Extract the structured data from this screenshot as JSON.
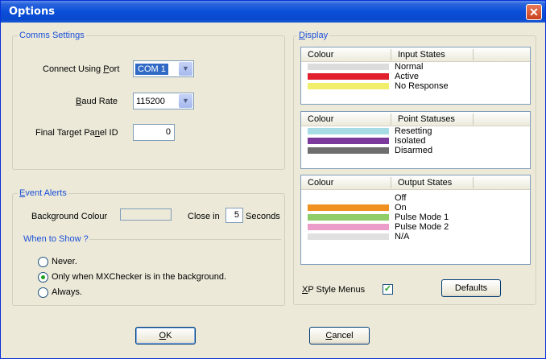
{
  "window": {
    "title": "Options",
    "close_glyph": "✕"
  },
  "comms": {
    "legend": "Comms Settings",
    "port_label_pre": "Connect Using ",
    "port_label_u": "P",
    "port_label_post": "ort",
    "port_value": "COM 1",
    "baud_label_pre": "",
    "baud_label_u": "B",
    "baud_label_post": "aud Rate",
    "baud_value": "115200",
    "panel_label_pre": "Final Target Pa",
    "panel_label_u": "n",
    "panel_label_post": "el ID",
    "panel_value": "0"
  },
  "event_alerts": {
    "legend_u": "E",
    "legend_post": "vent Alerts",
    "bg_colour_label": "Background Colour",
    "close_in_label": "Close in",
    "close_in_value": "5",
    "seconds_label": "Seconds"
  },
  "when_to_show": {
    "legend": "When to Show ?",
    "options": [
      {
        "label": "Never.",
        "checked": false
      },
      {
        "label": "Only when MXChecker is in the background.",
        "checked": true
      },
      {
        "label": "Always.",
        "checked": false
      }
    ]
  },
  "display": {
    "legend_u": "D",
    "legend_post": "isplay",
    "input_states": {
      "col1": "Colour",
      "col2": "Input States",
      "rows": [
        {
          "color": "#dcdcdc",
          "label": "Normal"
        },
        {
          "color": "#e0202c",
          "label": "Active"
        },
        {
          "color": "#f0ee6a",
          "label": "No Response"
        }
      ]
    },
    "point_statuses": {
      "col1": "Colour",
      "col2": "Point Statuses",
      "rows": [
        {
          "color": "#a8dce4",
          "label": "Resetting"
        },
        {
          "color": "#7c3a9c",
          "label": "Isolated"
        },
        {
          "color": "#6e6e6e",
          "label": "Disarmed"
        }
      ]
    },
    "output_states": {
      "col1": "Colour",
      "col2": "Output States",
      "rows": [
        {
          "color": "#ffffff",
          "label": "Off"
        },
        {
          "color": "#f09020",
          "label": "On"
        },
        {
          "color": "#90cc68",
          "label": "Pulse Mode 1"
        },
        {
          "color": "#ec9cc8",
          "label": "Pulse Mode 2"
        },
        {
          "color": "#e0e0e0",
          "label": "N/A"
        }
      ]
    },
    "xp_menus_u": "X",
    "xp_menus_post": "P Style Menus",
    "xp_menus_checked": true,
    "defaults_button": "Defaults"
  },
  "footer": {
    "ok_u": "O",
    "ok_post": "K",
    "cancel_u": "C",
    "cancel_post": "ancel"
  }
}
